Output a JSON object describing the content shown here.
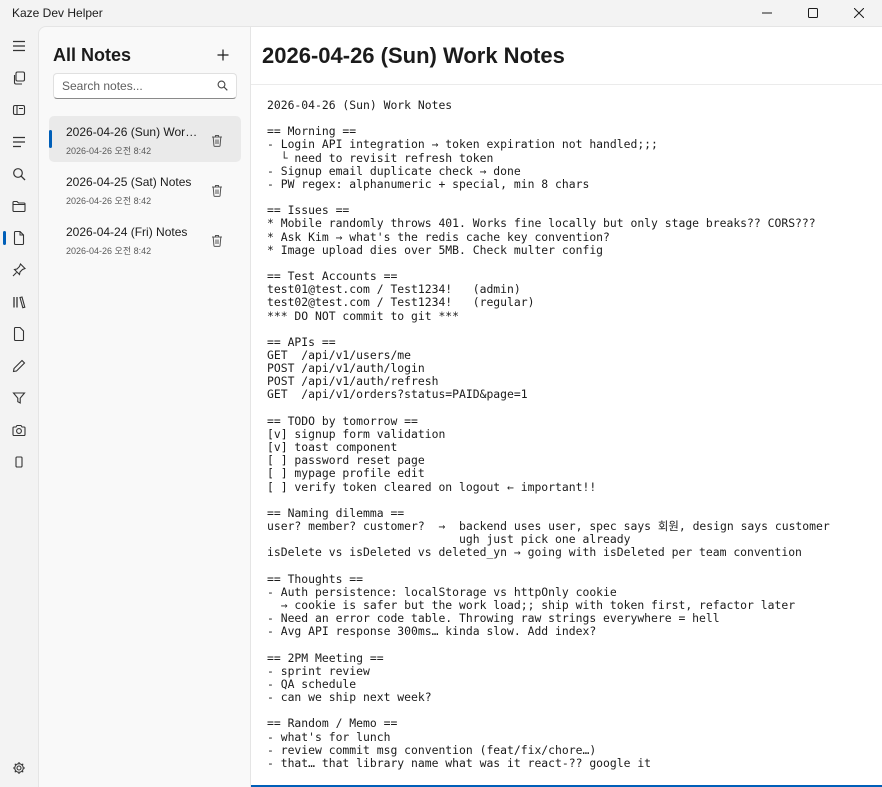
{
  "app": {
    "title": "Kaze Dev Helper"
  },
  "window_controls": [
    {
      "name": "minimize-button",
      "icon": "minimize-icon"
    },
    {
      "name": "maximize-button",
      "icon": "maximize-icon"
    },
    {
      "name": "close-button",
      "icon": "close-icon"
    }
  ],
  "nav": {
    "items": [
      {
        "icon": "hamburger-icon"
      },
      {
        "icon": "copy-icon"
      },
      {
        "icon": "book-icon"
      },
      {
        "icon": "list-icon"
      },
      {
        "icon": "search-icon"
      },
      {
        "icon": "folder-icon"
      },
      {
        "icon": "document-icon",
        "active": true
      },
      {
        "icon": "pin-icon"
      },
      {
        "icon": "library-icon"
      },
      {
        "icon": "page-icon"
      },
      {
        "icon": "pencil-icon"
      },
      {
        "icon": "filter-icon"
      },
      {
        "icon": "camera-icon"
      },
      {
        "icon": "phone-icon"
      }
    ],
    "settings_icon": "gear-icon",
    "accent": "#005fb8"
  },
  "sidebar": {
    "title": "All Notes",
    "add_icon": "plus-icon",
    "search": {
      "placeholder": "Search notes...",
      "value": ""
    },
    "notes": [
      {
        "title": "2026-04-26 (Sun) Work Notes",
        "date": "2026-04-26 오전 8:42",
        "selected": true
      },
      {
        "title": "2026-04-25 (Sat) Notes",
        "date": "2026-04-26 오전 8:42",
        "selected": false
      },
      {
        "title": "2026-04-24 (Fri) Notes",
        "date": "2026-04-26 오전 8:42",
        "selected": false
      }
    ]
  },
  "main": {
    "title": "2026-04-26 (Sun) Work Notes",
    "content": "2026-04-26 (Sun) Work Notes\n\n== Morning ==\n- Login API integration → token expiration not handled;;;\n  └ need to revisit refresh token\n- Signup email duplicate check → done\n- PW regex: alphanumeric + special, min 8 chars\n\n== Issues ==\n* Mobile randomly throws 401. Works fine locally but only stage breaks?? CORS???\n* Ask Kim → what's the redis cache key convention?\n* Image upload dies over 5MB. Check multer config\n\n== Test Accounts ==\ntest01@test.com / Test1234!   (admin)\ntest02@test.com / Test1234!   (regular)\n*** DO NOT commit to git ***\n\n== APIs ==\nGET  /api/v1/users/me\nPOST /api/v1/auth/login\nPOST /api/v1/auth/refresh\nGET  /api/v1/orders?status=PAID&page=1\n\n== TODO by tomorrow ==\n[v] signup form validation\n[v] toast component\n[ ] password reset page\n[ ] mypage profile edit\n[ ] verify token cleared on logout ← important!!\n\n== Naming dilemma ==\nuser? member? customer?  →  backend uses user, spec says 회원, design says customer\n                            ugh just pick one already\nisDelete vs isDeleted vs deleted_yn → going with isDeleted per team convention\n\n== Thoughts ==\n- Auth persistence: localStorage vs httpOnly cookie\n  → cookie is safer but the work load;; ship with token first, refactor later\n- Need an error code table. Throwing raw strings everywhere = hell\n- Avg API response 300ms… kinda slow. Add index?\n\n== 2PM Meeting ==\n- sprint review\n- QA schedule\n- can we ship next week?\n\n== Random / Memo ==\n- what's for lunch\n- review commit msg convention (feat/fix/chore…)\n- that… that library name what was it react-?? google it"
  }
}
